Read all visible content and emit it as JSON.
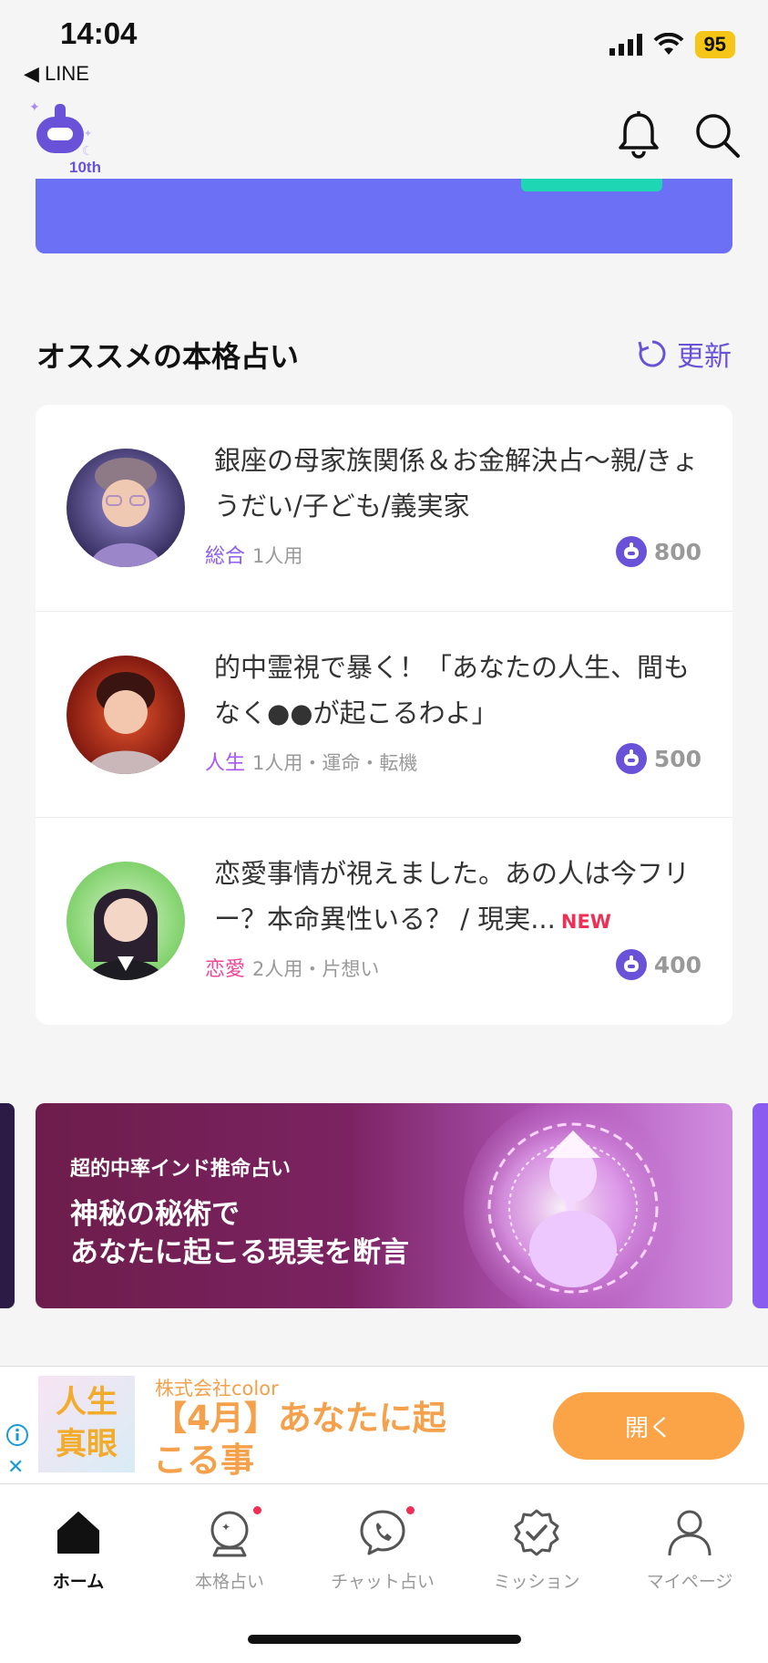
{
  "status_bar": {
    "time": "14:04",
    "back_app": "◀ LINE",
    "battery": "95"
  },
  "header": {
    "logo_badge": "10th"
  },
  "section": {
    "title": "オススメの本格占い",
    "refresh_label": "更新"
  },
  "readings": [
    {
      "title": "銀座の母家族関係＆お金解決占～親/きょうだい/子ども/義実家",
      "category": "総合",
      "category_color": "#8b5cf6",
      "meta": "1人用",
      "price": "800",
      "is_new": false,
      "new_label": ""
    },
    {
      "title": "的中霊視で暴く！「あなたの人生、間もなく●●が起こるわよ」",
      "category": "人生",
      "category_color": "#a855f7",
      "meta": "1人用・運命・転機",
      "price": "500",
      "is_new": false,
      "new_label": ""
    },
    {
      "title": "恋愛事情が視えました。あの人は今フリー？本命異性いる？ / 現実...",
      "category": "恋愛",
      "category_color": "#ec4899",
      "meta": "2人用・片想い",
      "price": "400",
      "is_new": true,
      "new_label": "NEW"
    }
  ],
  "promo": {
    "kicker": "超的中率インド推命占い",
    "line1": "神秘の秘術で",
    "line2": "あなたに起こる現実を断言"
  },
  "ad": {
    "thumb_line1": "人生",
    "thumb_line2": "真眼",
    "company": "株式会社color",
    "headline": "【4月】あなたに起こる事",
    "open_label": "開く",
    "close_glyph": "✕"
  },
  "tabbar": {
    "items": [
      {
        "label": "ホーム",
        "active": true,
        "dot": false
      },
      {
        "label": "本格占い",
        "active": false,
        "dot": true
      },
      {
        "label": "チャット占い",
        "active": false,
        "dot": true
      },
      {
        "label": "ミッション",
        "active": false,
        "dot": false
      },
      {
        "label": "マイページ",
        "active": false,
        "dot": false
      }
    ]
  },
  "colors": {
    "accent": "#6a52d8",
    "banner": "#6b70f4",
    "teal": "#1ed6b4",
    "new": "#ef2f55",
    "ad_orange": "#fba347"
  }
}
